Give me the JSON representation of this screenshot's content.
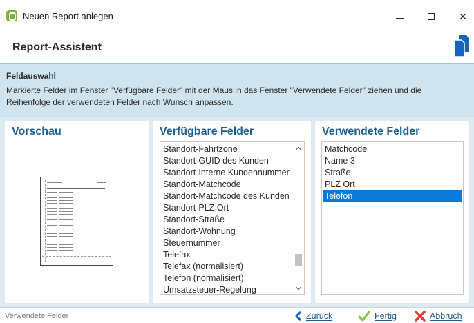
{
  "window": {
    "title": "Neuen Report anlegen",
    "icon": "app-leaf-icon",
    "controls": {
      "minimize": "minimize-icon",
      "maximize": "maximize-icon",
      "close": "close-icon",
      "close_glyph": "✕"
    }
  },
  "header": {
    "title": "Report-Assistent",
    "icon": "documents-icon"
  },
  "info": {
    "title": "Feldauswahl",
    "text": "Markierte Felder im Fenster \"Verfügbare Felder\" mit der Maus in das Fenster \"Verwendete Felder\" ziehen und die Reihenfolge der verwendeten Felder nach Wunsch anpassen."
  },
  "panels": {
    "preview": {
      "title": "Vorschau"
    },
    "available": {
      "title": "Verfügbare Felder",
      "items": [
        "Standort-Fahrtzone",
        "Standort-GUID des Kunden",
        "Standort-Interne Kundennummer",
        "Standort-Matchcode",
        "Standort-Matchcode des Kunden",
        "Standort-PLZ Ort",
        "Standort-Straße",
        "Standort-Wohnung",
        "Steuernummer",
        "Telefax",
        "Telefax (normalisiert)",
        "Telefon (normalisiert)",
        "Umsatzsteuer-Regelung"
      ]
    },
    "used": {
      "title": "Verwendete Felder",
      "items": [
        "Matchcode",
        "Name 3",
        "Straße",
        "PLZ Ort",
        "Telefon"
      ],
      "selected_index": 4
    }
  },
  "statusbar": {
    "text": "Verwendete Felder"
  },
  "buttons": {
    "back": {
      "label": "Zurück",
      "icon": "chevron-left-icon"
    },
    "finish": {
      "label": "Fertig",
      "icon": "checkmark-icon"
    },
    "cancel": {
      "label": "Abbruch",
      "icon": "x-cancel-icon"
    }
  },
  "colors": {
    "accent": "#1f5f90",
    "selection": "#0a7ad8",
    "info_background": "#cfe4ee",
    "content_background": "#ddeaf2",
    "finish_icon": "#8bc34a",
    "cancel_icon": "#e53935"
  }
}
